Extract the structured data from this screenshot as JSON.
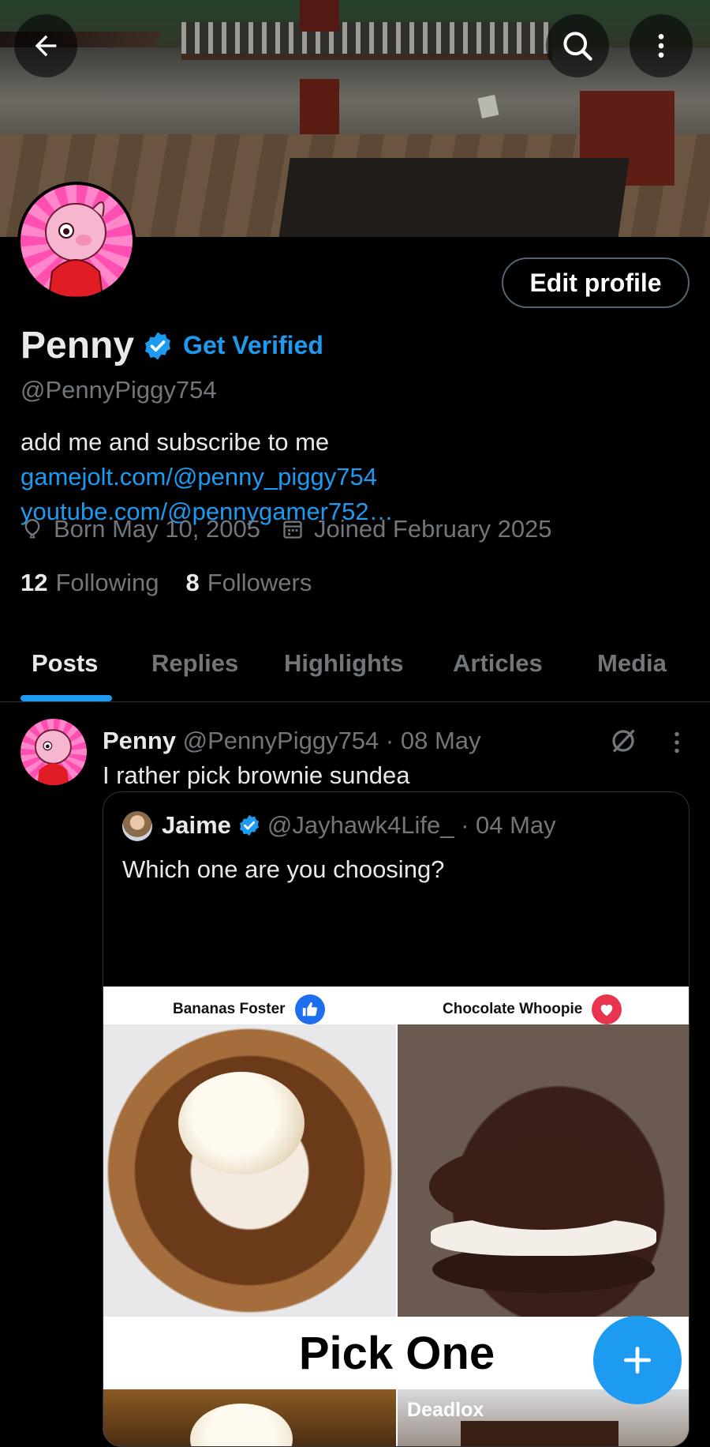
{
  "header": {
    "back_icon": "arrow-left-icon",
    "search_icon": "search-icon",
    "more_icon": "more-vertical-icon"
  },
  "profile": {
    "edit_label": "Edit profile",
    "name": "Penny",
    "get_verified": "Get Verified",
    "handle": "@PennyPiggy754",
    "bio_text": "add me and subscribe to me",
    "bio_link1": "gamejolt.com/@penny_piggy754",
    "bio_link2": "youtube.com/@pennygamer752…",
    "born": "Born May 10, 2005",
    "joined": "Joined February 2025",
    "following_count": "12",
    "following_label": "Following",
    "followers_count": "8",
    "followers_label": "Followers",
    "accent": "#1d9bf0"
  },
  "tabs": [
    "Posts",
    "Replies",
    "Highlights",
    "Articles",
    "Media"
  ],
  "post": {
    "author": "Penny",
    "handle": "@PennyPiggy754",
    "date": "· 08 May",
    "text": "I rather pick brownie sundea",
    "quote": {
      "author": "Jaime",
      "handle": "@Jayhawk4Life_",
      "date": "· 04 May",
      "text": "Which one are you choosing?",
      "media": {
        "caption_a": "Bananas Foster",
        "caption_b": "Chocolate Whoopie",
        "center_text": "Pick One",
        "caption_d": "Deadlox"
      }
    }
  },
  "fab_icon": "plus-icon"
}
